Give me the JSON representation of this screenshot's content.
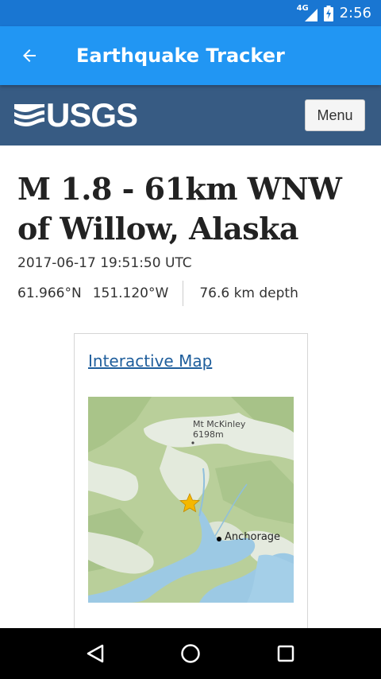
{
  "status_bar": {
    "network_label": "4G",
    "time": "2:56"
  },
  "app_bar": {
    "title": "Earthquake Tracker",
    "back_icon": "arrow-left-icon"
  },
  "usgs_header": {
    "logo_text": "USGS",
    "menu_label": "Menu"
  },
  "event": {
    "title": "M 1.8 - 61km WNW of Willow, Alaska",
    "timestamp": "2017-06-17 19:51:50 UTC",
    "latitude": "61.966°N",
    "longitude": "151.120°W",
    "depth": "76.6 km depth"
  },
  "map": {
    "link_label": "Interactive Map",
    "peak_label_line1": "Mt McKinley",
    "peak_label_line2": "6198m",
    "city_label": "Anchorage"
  },
  "nav": {
    "back_icon": "triangle-back-icon",
    "home_icon": "circle-home-icon",
    "recents_icon": "square-recents-icon"
  },
  "colors": {
    "status_bar": "#1976d2",
    "app_bar": "#2196f3",
    "usgs_header": "#375b83",
    "link": "#1f5e9c"
  }
}
